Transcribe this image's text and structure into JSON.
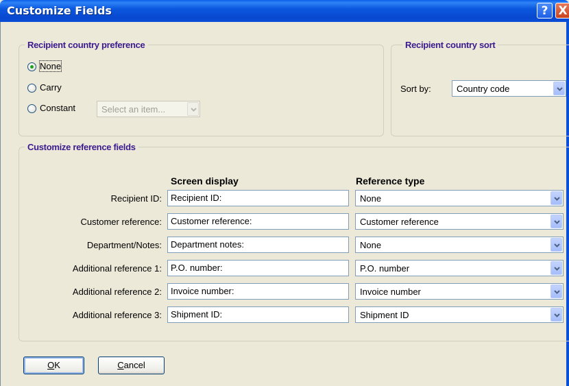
{
  "window": {
    "title": "Customize Fields",
    "help_icon": "?",
    "close_icon": "X"
  },
  "country_preference": {
    "legend": "Recipient country preference",
    "options": [
      {
        "label": "None",
        "checked": true
      },
      {
        "label": "Carry",
        "checked": false
      },
      {
        "label": "Constant",
        "checked": false
      }
    ],
    "constant_select": {
      "value": "Select an item...",
      "disabled": true
    }
  },
  "country_sort": {
    "legend": "Recipient country sort",
    "sort_by_label": "Sort by:",
    "sort_by_value": "Country code"
  },
  "reference_fields": {
    "legend": "Customize reference fields",
    "col_screen_display": "Screen display",
    "col_reference_type": "Reference type",
    "rows": [
      {
        "label": "Recipient ID:",
        "display": "Recipient ID:",
        "type": "None"
      },
      {
        "label": "Customer reference:",
        "display": "Customer reference:",
        "type": "Customer reference"
      },
      {
        "label": "Department/Notes:",
        "display": "Department notes:",
        "type": "None"
      },
      {
        "label": "Additional reference 1:",
        "display": "P.O. number:",
        "type": "P.O. number"
      },
      {
        "label": "Additional reference 2:",
        "display": "Invoice number:",
        "type": "Invoice number"
      },
      {
        "label": "Additional reference 3:",
        "display": "Shipment ID:",
        "type": "Shipment ID"
      }
    ]
  },
  "buttons": {
    "ok": {
      "label": "OK",
      "accel": "O",
      "rest": "K"
    },
    "cancel": {
      "label": "Cancel",
      "accel": "C",
      "rest": "ancel"
    }
  },
  "colors": {
    "titlebar": "#0a4fd6",
    "group_legend": "#3b1a8f",
    "dialog_bg": "#ece9d8"
  }
}
